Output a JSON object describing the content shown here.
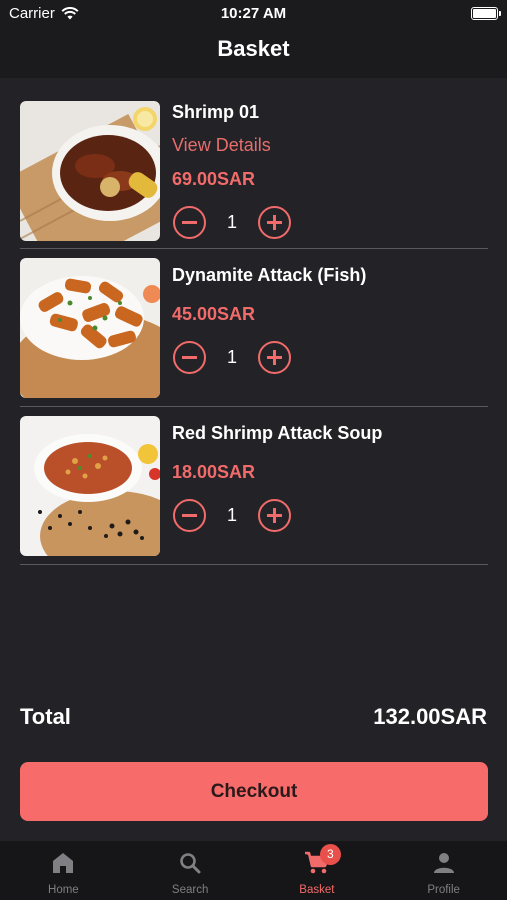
{
  "status_bar": {
    "carrier": "Carrier",
    "time": "10:27 AM"
  },
  "header": {
    "title": "Basket"
  },
  "items": [
    {
      "name": "Shrimp 01",
      "details_link": "View Details",
      "price": "69.00SAR",
      "quantity": "1"
    },
    {
      "name": "Dynamite Attack (Fish)",
      "price": "45.00SAR",
      "quantity": "1"
    },
    {
      "name": "Red Shrimp Attack Soup",
      "price": "18.00SAR",
      "quantity": "1"
    }
  ],
  "summary": {
    "total_label": "Total",
    "total_value": "132.00SAR"
  },
  "checkout_label": "Checkout",
  "tabbar": {
    "tabs": [
      {
        "label": "Home",
        "icon": "home-icon"
      },
      {
        "label": "Search",
        "icon": "search-icon"
      },
      {
        "label": "Basket",
        "icon": "cart-icon",
        "badge": "3",
        "active": true
      },
      {
        "label": "Profile",
        "icon": "person-icon"
      }
    ]
  },
  "colors": {
    "accent": "#f26b6b",
    "checkout_bg": "#f76b6b",
    "background": "#232327",
    "badge": "#e8504b"
  }
}
